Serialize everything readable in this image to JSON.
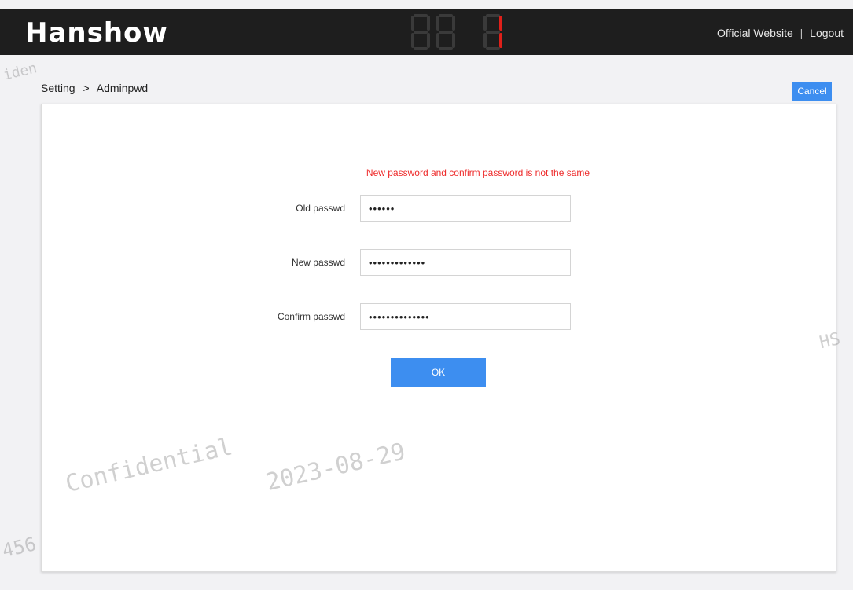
{
  "header": {
    "logo_text": "Hanshow",
    "links": {
      "official_website": "Official Website",
      "separator": "|",
      "logout": "Logout"
    }
  },
  "breadcrumb": {
    "parent": "Setting",
    "arrow": ">",
    "current": "Adminpwd"
  },
  "toolbar": {
    "cancel_label": "Cancel"
  },
  "form": {
    "error_message": "New password and confirm password is not the same",
    "old_password": {
      "label": "Old passwd",
      "value": "••••••"
    },
    "new_password": {
      "label": "New passwd",
      "value": "•••••••••••••"
    },
    "confirm_password": {
      "label": "Confirm passwd",
      "value": "••••••••••••••"
    },
    "ok_label": "OK"
  },
  "watermark": {
    "date": "2023-08-29",
    "confidential": "Confidential",
    "fragment_left": "456",
    "fragment_right": "HS",
    "fragment_top_left": "iden"
  },
  "colors": {
    "header_bg": "#1e1e1e",
    "accent_blue": "#3d8ef0",
    "error_red": "#ee2b2b",
    "segment_on": "#e0201a"
  }
}
